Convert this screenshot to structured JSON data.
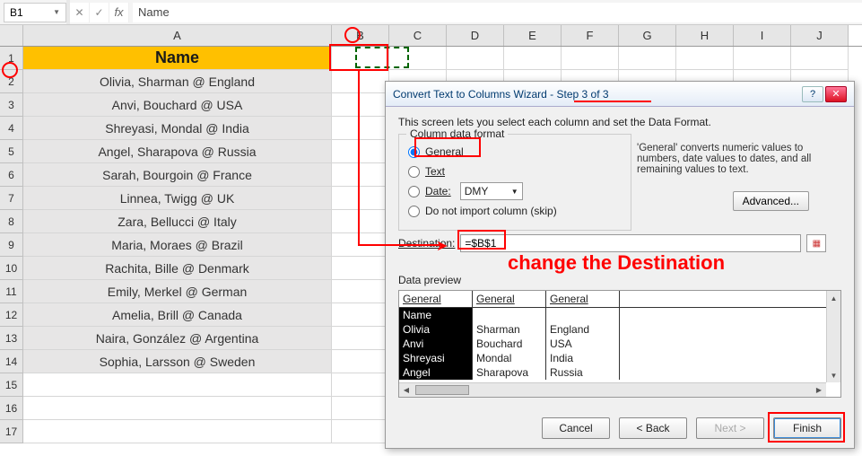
{
  "namebox": "B1",
  "fx_value": "Name",
  "columns": [
    "A",
    "B",
    "C",
    "D",
    "E",
    "F",
    "G",
    "H",
    "I",
    "J"
  ],
  "rows_visible": 17,
  "header_label": "Name",
  "data_rows": [
    "Olivia, Sharman @ England",
    "Anvi, Bouchard @ USA",
    "Shreyasi, Mondal @ India",
    "Angel, Sharapova @ Russia",
    "Sarah, Bourgoin @ France",
    "Linnea, Twigg @ UK",
    "Zara, Bellucci @ Italy",
    "Maria, Moraes @ Brazil",
    "Rachita, Bille @ Denmark",
    "Emily, Merkel @ German",
    "Amelia, Brill @ Canada",
    "Naira, González @ Argentina",
    "Sophia, Larsson @ Sweden"
  ],
  "annotation_text": "change the Destination",
  "dialog": {
    "title": "Convert Text to Columns Wizard - Step 3 of 3",
    "intro": "This screen lets you select each column and set the Data Format.",
    "group_legend": "Column data format",
    "radio_general": "General",
    "radio_text": "Text",
    "radio_date": "Date:",
    "date_combo": "DMY",
    "radio_skip": "Do not import column (skip)",
    "side_text": "'General' converts numeric values to numbers, date values to dates, and all remaining values to text.",
    "advanced": "Advanced...",
    "destination_label": "Destination:",
    "destination_value": "=$B$1",
    "preview_label": "Data preview",
    "preview_headers": [
      "General",
      "General",
      "General"
    ],
    "preview_rows": [
      [
        "Name",
        "",
        ""
      ],
      [
        "Olivia",
        "Sharman",
        "England"
      ],
      [
        "Anvi",
        "Bouchard",
        "USA"
      ],
      [
        "Shreyasi",
        "Mondal",
        "India"
      ],
      [
        "Angel",
        "Sharapova",
        "Russia"
      ]
    ],
    "btn_cancel": "Cancel",
    "btn_back": "< Back",
    "btn_next": "Next >",
    "btn_finish": "Finish"
  }
}
